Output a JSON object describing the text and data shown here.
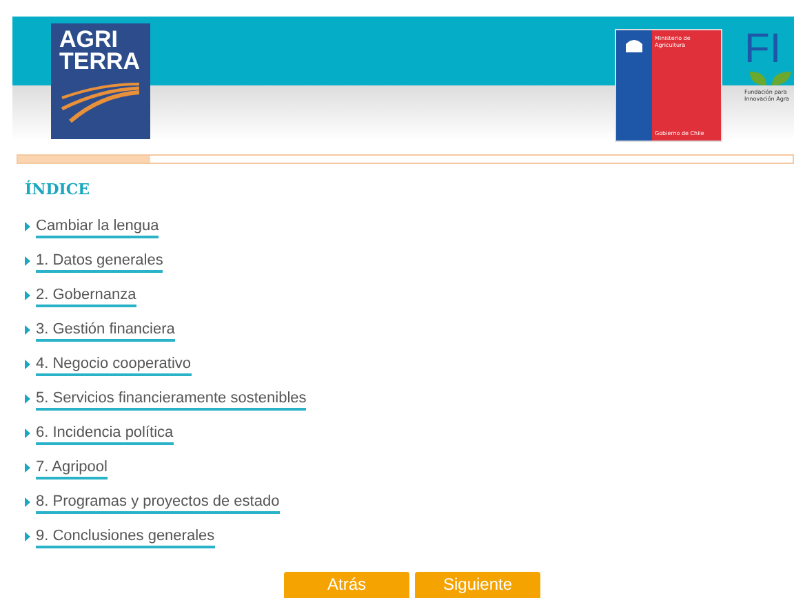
{
  "header": {
    "logo_lines": [
      "AGRI",
      "TERRA"
    ],
    "ministry_logo": {
      "title_lines": [
        "Ministerio de",
        "Agricultura"
      ],
      "footer": "Gobierno de Chile"
    },
    "fia_logo": {
      "letters": "FI",
      "caption_lines": [
        "Fundación para",
        "Innovación Agra"
      ]
    }
  },
  "progress": {
    "level": 0.17
  },
  "index": {
    "title": "ÍNDICE",
    "items": [
      {
        "label": "Cambiar la lengua"
      },
      {
        "label": "1. Datos generales"
      },
      {
        "label": "2. Gobernanza"
      },
      {
        "label": "3. Gestión financiera"
      },
      {
        "label": "4. Negocio cooperativo"
      },
      {
        "label": "5. Servicios financieramente sostenibles"
      },
      {
        "label": "6. Incidencia política"
      },
      {
        "label": "7. Agripool"
      },
      {
        "label": "8. Programas y proyectos de estado"
      },
      {
        "label": "9. Conclusiones generales"
      }
    ]
  },
  "buttons": [
    {
      "label": "Atrás"
    },
    {
      "label": "Siguiente"
    }
  ]
}
